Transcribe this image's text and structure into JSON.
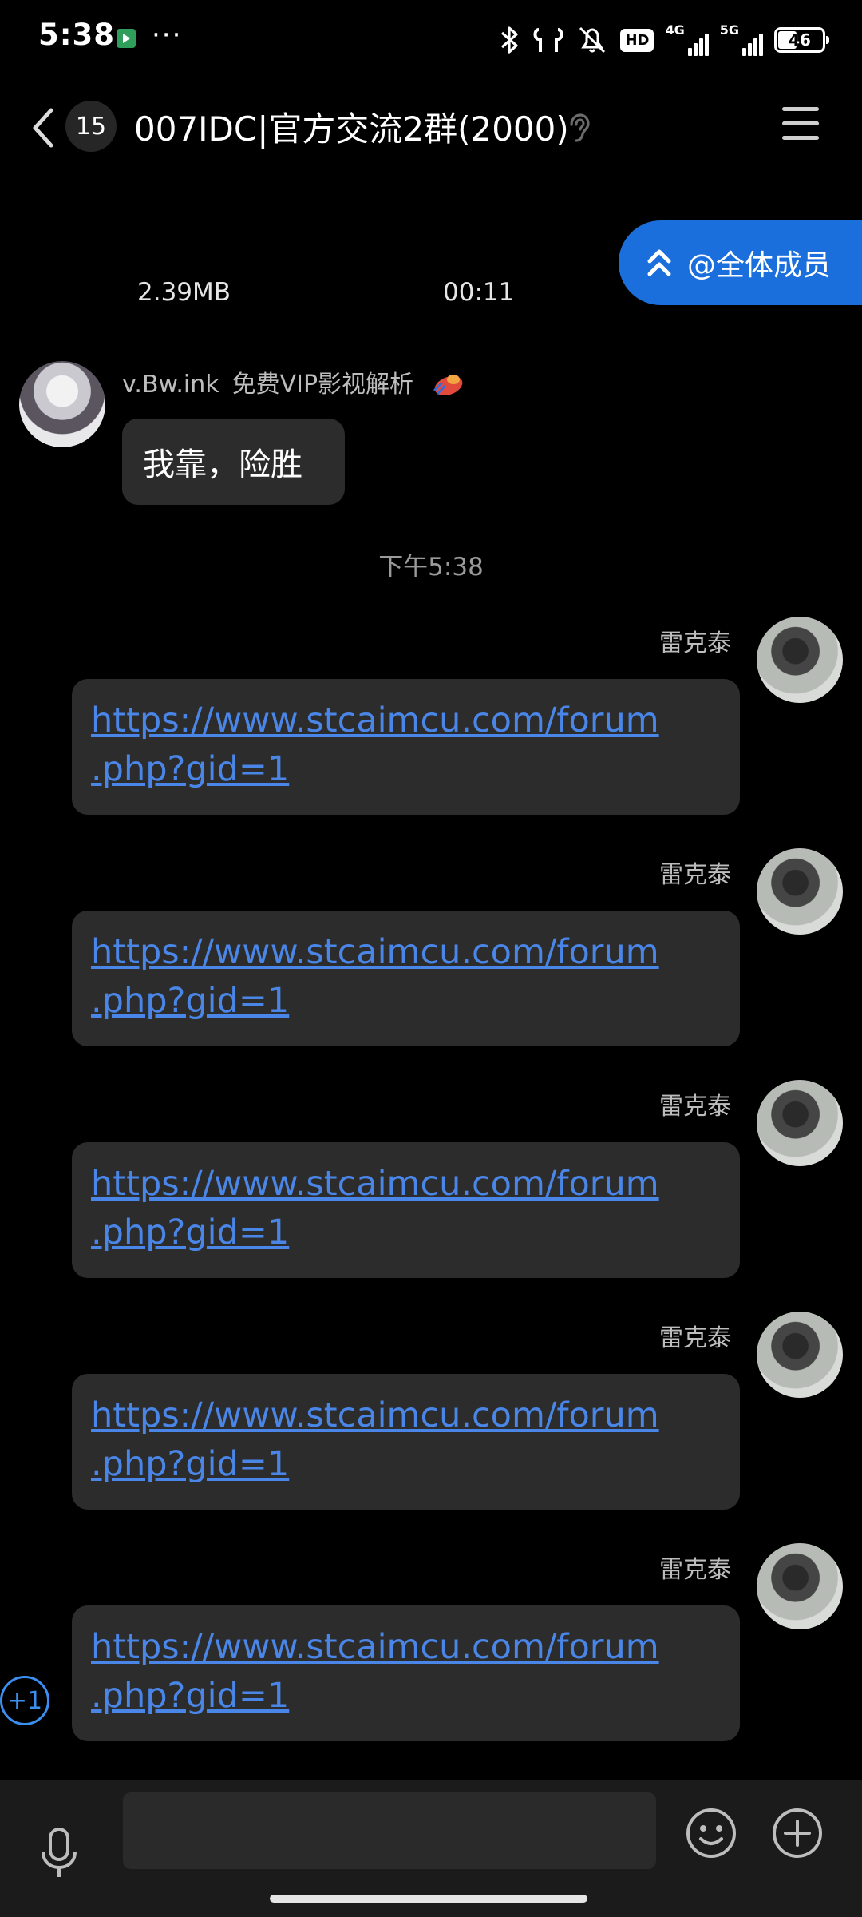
{
  "status_bar": {
    "time": "5:38",
    "more": "···",
    "hd_label": "HD",
    "net1_label": "4G",
    "net2_label": "5G",
    "battery_level": "46",
    "battery_fraction": 0.46
  },
  "header": {
    "unread_count": "15",
    "title": "007IDC|官方交流2群(2000)"
  },
  "at_all": {
    "label": "@全体成员"
  },
  "file_message": {
    "size": "2.39MB",
    "duration": "00:11"
  },
  "messages": [
    {
      "sender": "v.Bw.ink",
      "sender_tag": "免费VIP影视解析",
      "text": "我靠，险胜"
    }
  ],
  "time_divider": "下午5:38",
  "link_messages": [
    {
      "sender": "雷克泰",
      "text": "https://www.stcaimcu.com/forum\n.php?gid=1"
    },
    {
      "sender": "雷克泰",
      "text": "https://www.stcaimcu.com/forum\n.php?gid=1"
    },
    {
      "sender": "雷克泰",
      "text": "https://www.stcaimcu.com/forum\n.php?gid=1"
    },
    {
      "sender": "雷克泰",
      "text": "https://www.stcaimcu.com/forum\n.php?gid=1"
    },
    {
      "sender": "雷克泰",
      "text": "https://www.stcaimcu.com/forum\n.php?gid=1"
    }
  ],
  "plus_one": "+1",
  "input": {
    "value": "",
    "placeholder": ""
  },
  "colors": {
    "accent": "#1a6fdd",
    "link": "#4a86e8",
    "bubble": "#2c2c2c",
    "background": "#000000"
  },
  "icons": [
    "back-icon",
    "ear-icon",
    "menu-icon",
    "double-chevron-up-icon",
    "mic-icon",
    "emoji-icon",
    "plus-icon"
  ]
}
